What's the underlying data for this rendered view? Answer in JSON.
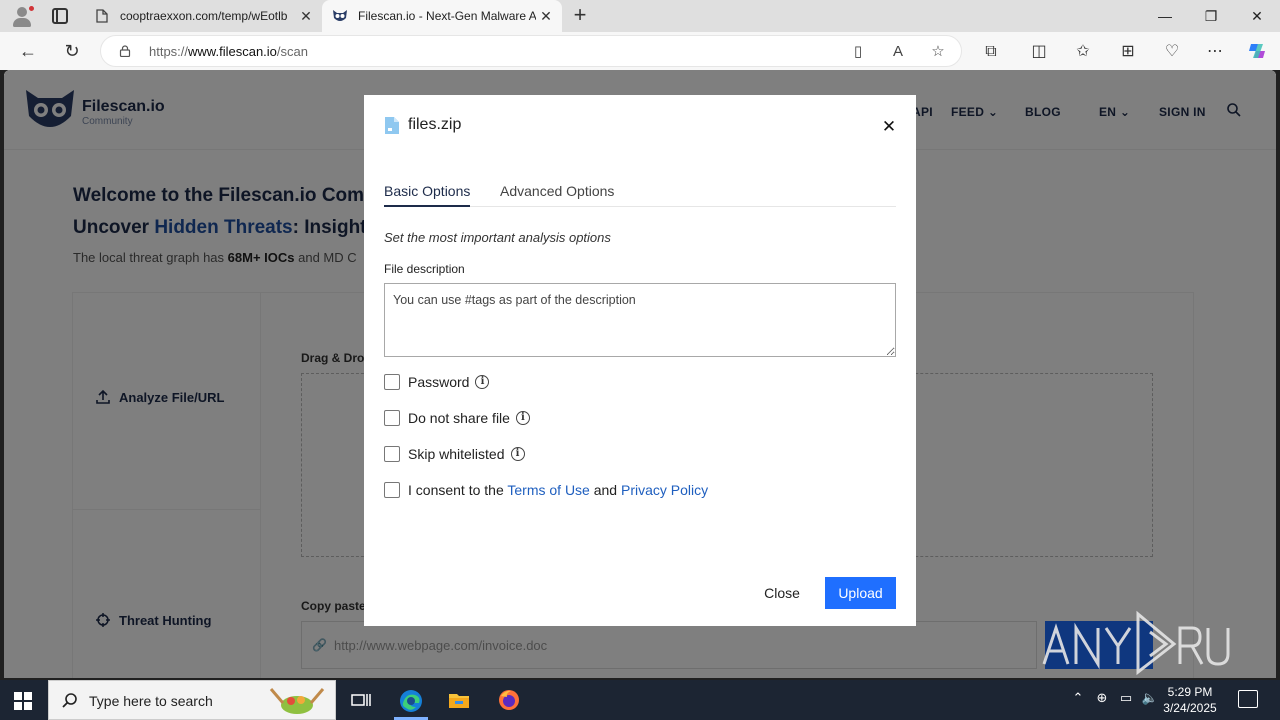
{
  "browser": {
    "tabs": [
      {
        "title": "cooptraexxon.com/temp/wEotlb"
      },
      {
        "title": "Filescan.io - Next-Gen Malware A"
      }
    ],
    "url_prefix": "https://",
    "url_host": "www.filescan.io",
    "url_path": "/scan"
  },
  "site": {
    "logo_name": "Filescan.io",
    "logo_sub": "Community",
    "nav": {
      "api": "API",
      "feed": "FEED",
      "blog": "BLOG",
      "lang": "EN",
      "signin": "SIGN IN"
    },
    "welcome": "Welcome to the Filescan.io Community",
    "subtitle_pre": "Uncover ",
    "subtitle_mid": "Hidden Threats",
    "subtitle_post": ": Insightful",
    "blurb_pre": "The local threat graph has ",
    "blurb_bold": "68M+ IOCs",
    "blurb_post": " and MD C",
    "side_analyze": "Analyze File/URL",
    "side_hunting": "Threat Hunting",
    "drag_label": "Drag & Drop",
    "copy_label": "Copy paste",
    "url_placeholder": "http://www.webpage.com/invoice.doc"
  },
  "modal": {
    "file_name": "files.zip",
    "tabs": {
      "basic": "Basic Options",
      "advanced": "Advanced Options"
    },
    "hint": "Set the most important analysis options",
    "desc_label": "File description",
    "desc_placeholder": "You can use #tags as part of the description",
    "options": {
      "password": "Password",
      "noshare": "Do not share file",
      "skip": "Skip whitelisted"
    },
    "consent": {
      "pre": "I consent to the ",
      "terms": "Terms of Use",
      "and": " and ",
      "privacy": "Privacy Policy"
    },
    "close_label": "Close",
    "upload_label": "Upload"
  },
  "taskbar": {
    "search_text": "Type here to search",
    "time": "5:29 PM",
    "date": "3/24/2025"
  },
  "colors": {
    "accent": "#1f6fff",
    "link": "#1f5fbf",
    "brand_dark": "#1d2b4a"
  }
}
